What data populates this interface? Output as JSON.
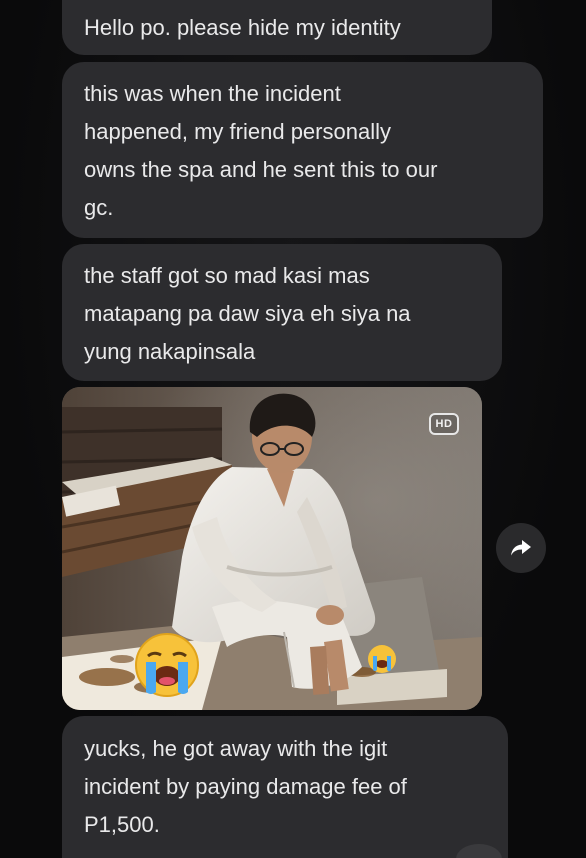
{
  "messages": [
    {
      "text": "Hello po. please hide my identity"
    },
    {
      "lines": [
        "this was when the incident",
        "happened, my friend personally",
        "owns the spa and he sent this to our",
        "gc."
      ]
    },
    {
      "lines": [
        "the staff got so mad kasi mas",
        "matapang pa daw siya eh siya na",
        "yung nakapinsala"
      ]
    },
    {
      "lines": [
        "yucks, he got away with the igit",
        "incident by paying damage fee of",
        "P1,500."
      ]
    }
  ],
  "photo": {
    "badge": "HD",
    "reactions": [
      "crying-face",
      "crying-face"
    ]
  },
  "colors": {
    "background": "#0d0d0f",
    "bubble": "#2c2c2f",
    "text": "#e9e9ea"
  },
  "icons": {
    "forward": "share-arrow-icon",
    "badge": "hd-badge-icon",
    "emoji": "loudly-crying-face-icon"
  }
}
